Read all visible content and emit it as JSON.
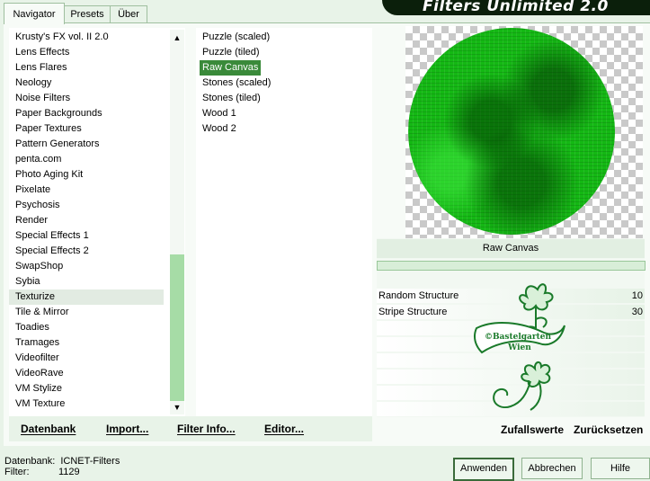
{
  "tabs": [
    "Navigator",
    "Presets",
    "Über"
  ],
  "title": "Filters Unlimited 2.0",
  "categories": [
    "Krusty's FX vol. II 2.0",
    "Lens Effects",
    "Lens Flares",
    "Neology",
    "Noise Filters",
    "Paper Backgrounds",
    "Paper Textures",
    "Pattern Generators",
    "penta.com",
    "Photo Aging Kit",
    "Pixelate",
    "Psychosis",
    "Render",
    "Special Effects 1",
    "Special Effects 2",
    "SwapShop",
    "Sybia",
    "Texturize",
    "Tile & Mirror",
    "Toadies",
    "Tramages",
    "Videofilter",
    "VideoRave",
    "VM Stylize",
    "VM Texture"
  ],
  "selected_category": "Texturize",
  "filters": [
    "Puzzle (scaled)",
    "Puzzle (tiled)",
    "Raw Canvas",
    "Stones (scaled)",
    "Stones (tiled)",
    "Wood 1",
    "Wood 2"
  ],
  "selected_filter": "Raw Canvas",
  "scroll_up_glyph": "▲",
  "scroll_down_glyph": "▼",
  "bottom_buttons": {
    "database": "Datenbank",
    "import": "Import...",
    "filter_info": "Filter Info...",
    "editor": "Editor..."
  },
  "preview_filter_name": "Raw Canvas",
  "params": [
    {
      "label": "Random Structure",
      "value": "10"
    },
    {
      "label": "Stripe Structure",
      "value": "30"
    }
  ],
  "random_button": "Zufallswerte",
  "reset_button": "Zurücksetzen",
  "watermark": {
    "line1": "©Bastelgarten",
    "line2": "Wien"
  },
  "status": {
    "db_label": "Datenbank:",
    "db_value": "ICNET-Filters",
    "filter_label": "Filter:",
    "filter_value": "1129"
  },
  "actions": {
    "apply": "Anwenden",
    "cancel": "Abbrechen",
    "help": "Hilfe"
  },
  "colors": {
    "accent": "#3a8a3a",
    "preview_green": "#14b814",
    "scroll_thumb": "#a6dca6",
    "background": "#e8f3e8"
  }
}
